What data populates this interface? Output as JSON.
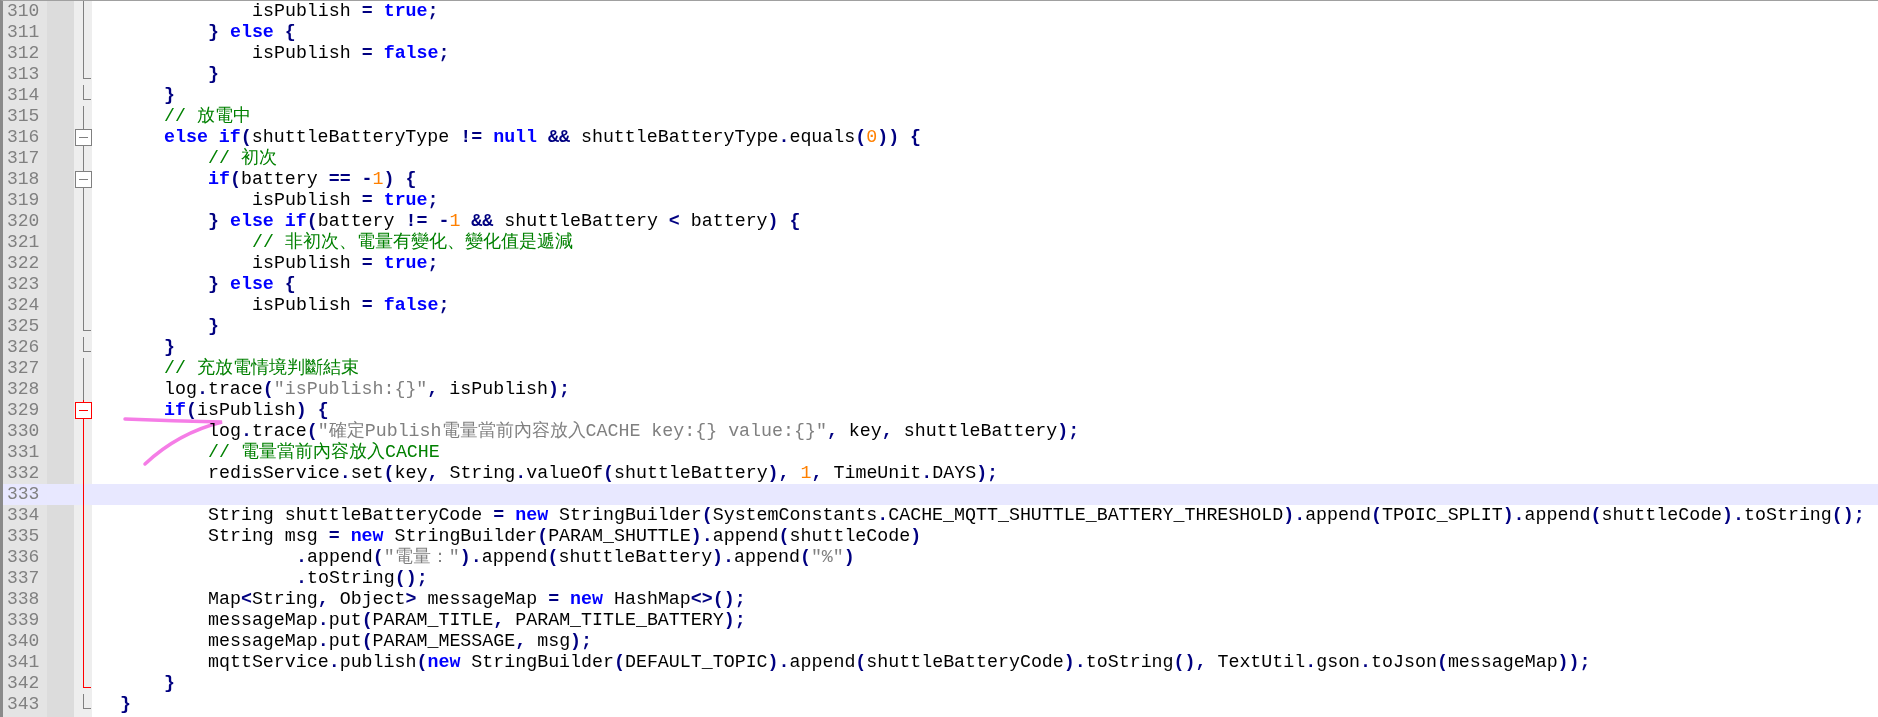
{
  "editor": {
    "lines": [
      {
        "number": "310",
        "kind": "line",
        "fold_highlight": false,
        "current": false,
        "tokens": [
          {
            "kind": "txt",
            "text": "              isPublish "
          },
          {
            "kind": "op",
            "text": "= "
          },
          {
            "kind": "kw",
            "text": "true"
          },
          {
            "kind": "op",
            "text": ";"
          }
        ]
      },
      {
        "number": "311",
        "kind": "line",
        "fold_highlight": false,
        "current": false,
        "tokens": [
          {
            "kind": "op",
            "text": "          } "
          },
          {
            "kind": "kw",
            "text": "else "
          },
          {
            "kind": "op",
            "text": "{"
          }
        ]
      },
      {
        "number": "312",
        "kind": "line",
        "fold_highlight": false,
        "current": false,
        "tokens": [
          {
            "kind": "txt",
            "text": "              isPublish "
          },
          {
            "kind": "op",
            "text": "= "
          },
          {
            "kind": "kw",
            "text": "false"
          },
          {
            "kind": "op",
            "text": ";"
          }
        ]
      },
      {
        "number": "313",
        "kind": "end",
        "fold_highlight": false,
        "current": false,
        "tokens": [
          {
            "kind": "op",
            "text": "          }"
          }
        ]
      },
      {
        "number": "314",
        "kind": "end",
        "fold_highlight": false,
        "current": false,
        "tokens": [
          {
            "kind": "op",
            "text": "      }"
          }
        ]
      },
      {
        "number": "315",
        "kind": "line",
        "fold_highlight": false,
        "current": false,
        "tokens": [
          {
            "kind": "cmt",
            "text": "      // 放電中"
          }
        ]
      },
      {
        "number": "316",
        "kind": "open",
        "fold_highlight": false,
        "current": false,
        "tokens": [
          {
            "kind": "kw",
            "text": "      else if"
          },
          {
            "kind": "op",
            "text": "("
          },
          {
            "kind": "txt",
            "text": "shuttleBatteryType "
          },
          {
            "kind": "op",
            "text": "!= "
          },
          {
            "kind": "kw",
            "text": "null "
          },
          {
            "kind": "op",
            "text": "&&"
          },
          {
            "kind": "txt",
            "text": " shuttleBatteryType"
          },
          {
            "kind": "op",
            "text": "."
          },
          {
            "kind": "txt",
            "text": "equals"
          },
          {
            "kind": "op",
            "text": "("
          },
          {
            "kind": "num",
            "text": "0"
          },
          {
            "kind": "op",
            "text": ")) {"
          }
        ]
      },
      {
        "number": "317",
        "kind": "line",
        "fold_highlight": false,
        "current": false,
        "tokens": [
          {
            "kind": "cmt",
            "text": "          // 初次"
          }
        ]
      },
      {
        "number": "318",
        "kind": "open",
        "fold_highlight": false,
        "current": false,
        "tokens": [
          {
            "kind": "kw",
            "text": "          if"
          },
          {
            "kind": "op",
            "text": "("
          },
          {
            "kind": "txt",
            "text": "battery "
          },
          {
            "kind": "op",
            "text": "== -"
          },
          {
            "kind": "num",
            "text": "1"
          },
          {
            "kind": "op",
            "text": ") {"
          }
        ]
      },
      {
        "number": "319",
        "kind": "line",
        "fold_highlight": false,
        "current": false,
        "tokens": [
          {
            "kind": "txt",
            "text": "              isPublish "
          },
          {
            "kind": "op",
            "text": "= "
          },
          {
            "kind": "kw",
            "text": "true"
          },
          {
            "kind": "op",
            "text": ";"
          }
        ]
      },
      {
        "number": "320",
        "kind": "line",
        "fold_highlight": false,
        "current": false,
        "tokens": [
          {
            "kind": "op",
            "text": "          } "
          },
          {
            "kind": "kw",
            "text": "else if"
          },
          {
            "kind": "op",
            "text": "("
          },
          {
            "kind": "txt",
            "text": "battery "
          },
          {
            "kind": "op",
            "text": "!= -"
          },
          {
            "kind": "num",
            "text": "1"
          },
          {
            "kind": "op",
            "text": " &&"
          },
          {
            "kind": "txt",
            "text": " shuttleBattery "
          },
          {
            "kind": "op",
            "text": "<"
          },
          {
            "kind": "txt",
            "text": " battery"
          },
          {
            "kind": "op",
            "text": ") {"
          }
        ]
      },
      {
        "number": "321",
        "kind": "line",
        "fold_highlight": false,
        "current": false,
        "tokens": [
          {
            "kind": "cmt",
            "text": "              // 非初次、電量有變化、變化值是遞減"
          }
        ]
      },
      {
        "number": "322",
        "kind": "line",
        "fold_highlight": false,
        "current": false,
        "tokens": [
          {
            "kind": "txt",
            "text": "              isPublish "
          },
          {
            "kind": "op",
            "text": "= "
          },
          {
            "kind": "kw",
            "text": "true"
          },
          {
            "kind": "op",
            "text": ";"
          }
        ]
      },
      {
        "number": "323",
        "kind": "line",
        "fold_highlight": false,
        "current": false,
        "tokens": [
          {
            "kind": "op",
            "text": "          } "
          },
          {
            "kind": "kw",
            "text": "else "
          },
          {
            "kind": "op",
            "text": "{"
          }
        ]
      },
      {
        "number": "324",
        "kind": "line",
        "fold_highlight": false,
        "current": false,
        "tokens": [
          {
            "kind": "txt",
            "text": "              isPublish "
          },
          {
            "kind": "op",
            "text": "= "
          },
          {
            "kind": "kw",
            "text": "false"
          },
          {
            "kind": "op",
            "text": ";"
          }
        ]
      },
      {
        "number": "325",
        "kind": "end",
        "fold_highlight": false,
        "current": false,
        "tokens": [
          {
            "kind": "op",
            "text": "          }"
          }
        ]
      },
      {
        "number": "326",
        "kind": "end",
        "fold_highlight": false,
        "current": false,
        "tokens": [
          {
            "kind": "op",
            "text": "      }"
          }
        ]
      },
      {
        "number": "327",
        "kind": "line",
        "fold_highlight": false,
        "current": false,
        "tokens": [
          {
            "kind": "cmt",
            "text": "      // 充放電情境判斷結束"
          }
        ]
      },
      {
        "number": "328",
        "kind": "line",
        "fold_highlight": false,
        "current": false,
        "tokens": [
          {
            "kind": "txt",
            "text": "      log"
          },
          {
            "kind": "op",
            "text": "."
          },
          {
            "kind": "txt",
            "text": "trace"
          },
          {
            "kind": "op",
            "text": "("
          },
          {
            "kind": "str",
            "text": "\"isPublish:{}\""
          },
          {
            "kind": "op",
            "text": ","
          },
          {
            "kind": "txt",
            "text": " isPublish"
          },
          {
            "kind": "op",
            "text": ");"
          }
        ]
      },
      {
        "number": "329",
        "kind": "open",
        "fold_highlight": true,
        "current": false,
        "tokens": [
          {
            "kind": "kw",
            "text": "      if"
          },
          {
            "kind": "op",
            "text": "("
          },
          {
            "kind": "txt",
            "text": "isPublish"
          },
          {
            "kind": "op",
            "text": ") {"
          }
        ]
      },
      {
        "number": "330",
        "kind": "line",
        "fold_highlight": true,
        "current": false,
        "tokens": [
          {
            "kind": "txt",
            "text": "          log"
          },
          {
            "kind": "op",
            "text": "."
          },
          {
            "kind": "txt",
            "text": "trace"
          },
          {
            "kind": "op",
            "text": "("
          },
          {
            "kind": "str",
            "text": "\"確定Publish電量當前內容放入CACHE key:{} value:{}\""
          },
          {
            "kind": "op",
            "text": ","
          },
          {
            "kind": "txt",
            "text": " key"
          },
          {
            "kind": "op",
            "text": ","
          },
          {
            "kind": "txt",
            "text": " shuttleBattery"
          },
          {
            "kind": "op",
            "text": ");"
          }
        ]
      },
      {
        "number": "331",
        "kind": "line",
        "fold_highlight": true,
        "current": false,
        "tokens": [
          {
            "kind": "cmt",
            "text": "          // 電量當前內容放入CACHE"
          }
        ]
      },
      {
        "number": "332",
        "kind": "line",
        "fold_highlight": true,
        "current": false,
        "tokens": [
          {
            "kind": "txt",
            "text": "          redisService"
          },
          {
            "kind": "op",
            "text": "."
          },
          {
            "kind": "txt",
            "text": "set"
          },
          {
            "kind": "op",
            "text": "("
          },
          {
            "kind": "txt",
            "text": "key"
          },
          {
            "kind": "op",
            "text": ","
          },
          {
            "kind": "txt",
            "text": " String"
          },
          {
            "kind": "op",
            "text": "."
          },
          {
            "kind": "txt",
            "text": "valueOf"
          },
          {
            "kind": "op",
            "text": "("
          },
          {
            "kind": "txt",
            "text": "shuttleBattery"
          },
          {
            "kind": "op",
            "text": "), "
          },
          {
            "kind": "num",
            "text": "1"
          },
          {
            "kind": "op",
            "text": ","
          },
          {
            "kind": "txt",
            "text": " TimeUnit"
          },
          {
            "kind": "op",
            "text": "."
          },
          {
            "kind": "txt",
            "text": "DAYS"
          },
          {
            "kind": "op",
            "text": ");"
          }
        ]
      },
      {
        "number": "333",
        "kind": "line",
        "fold_highlight": true,
        "current": true
      },
      {
        "number": "334",
        "kind": "line",
        "fold_highlight": true,
        "current": false,
        "tokens": [
          {
            "kind": "txt",
            "text": "          String shuttleBatteryCode "
          },
          {
            "kind": "op",
            "text": "= "
          },
          {
            "kind": "kw",
            "text": "new"
          },
          {
            "kind": "txt",
            "text": " StringBuilder"
          },
          {
            "kind": "op",
            "text": "("
          },
          {
            "kind": "txt",
            "text": "SystemConstants"
          },
          {
            "kind": "op",
            "text": "."
          },
          {
            "kind": "txt",
            "text": "CACHE_MQTT_SHUTTLE_BATTERY_THRESHOLD"
          },
          {
            "kind": "op",
            "text": ")."
          },
          {
            "kind": "txt",
            "text": "append"
          },
          {
            "kind": "op",
            "text": "("
          },
          {
            "kind": "txt",
            "text": "TPOIC_SPLIT"
          },
          {
            "kind": "op",
            "text": ")."
          },
          {
            "kind": "txt",
            "text": "append"
          },
          {
            "kind": "op",
            "text": "("
          },
          {
            "kind": "txt",
            "text": "shuttleCode"
          },
          {
            "kind": "op",
            "text": ")."
          },
          {
            "kind": "txt",
            "text": "toString"
          },
          {
            "kind": "op",
            "text": "();"
          }
        ]
      },
      {
        "number": "335",
        "kind": "line",
        "fold_highlight": true,
        "current": false,
        "tokens": [
          {
            "kind": "txt",
            "text": "          String msg "
          },
          {
            "kind": "op",
            "text": "= "
          },
          {
            "kind": "kw",
            "text": "new"
          },
          {
            "kind": "txt",
            "text": " StringBuilder"
          },
          {
            "kind": "op",
            "text": "("
          },
          {
            "kind": "txt",
            "text": "PARAM_SHUTTLE"
          },
          {
            "kind": "op",
            "text": ")."
          },
          {
            "kind": "txt",
            "text": "append"
          },
          {
            "kind": "op",
            "text": "("
          },
          {
            "kind": "txt",
            "text": "shuttleCode"
          },
          {
            "kind": "op",
            "text": ")"
          }
        ]
      },
      {
        "number": "336",
        "kind": "line",
        "fold_highlight": true,
        "current": false,
        "tokens": [
          {
            "kind": "op",
            "text": "                  ."
          },
          {
            "kind": "txt",
            "text": "append"
          },
          {
            "kind": "op",
            "text": "("
          },
          {
            "kind": "str",
            "text": "\"電量：\""
          },
          {
            "kind": "op",
            "text": ")."
          },
          {
            "kind": "txt",
            "text": "append"
          },
          {
            "kind": "op",
            "text": "("
          },
          {
            "kind": "txt",
            "text": "shuttleBattery"
          },
          {
            "kind": "op",
            "text": ")."
          },
          {
            "kind": "txt",
            "text": "append"
          },
          {
            "kind": "op",
            "text": "("
          },
          {
            "kind": "str",
            "text": "\"%\""
          },
          {
            "kind": "op",
            "text": ")"
          }
        ]
      },
      {
        "number": "337",
        "kind": "line",
        "fold_highlight": true,
        "current": false,
        "tokens": [
          {
            "kind": "op",
            "text": "                  ."
          },
          {
            "kind": "txt",
            "text": "toString"
          },
          {
            "kind": "op",
            "text": "();"
          }
        ]
      },
      {
        "number": "338",
        "kind": "line",
        "fold_highlight": true,
        "current": false,
        "tokens": [
          {
            "kind": "txt",
            "text": "          Map"
          },
          {
            "kind": "op",
            "text": "<"
          },
          {
            "kind": "txt",
            "text": "String"
          },
          {
            "kind": "op",
            "text": ","
          },
          {
            "kind": "txt",
            "text": " Object"
          },
          {
            "kind": "op",
            "text": ">"
          },
          {
            "kind": "txt",
            "text": " messageMap "
          },
          {
            "kind": "op",
            "text": "= "
          },
          {
            "kind": "kw",
            "text": "new"
          },
          {
            "kind": "txt",
            "text": " HashMap"
          },
          {
            "kind": "op",
            "text": "<>();"
          }
        ]
      },
      {
        "number": "339",
        "kind": "line",
        "fold_highlight": true,
        "current": false,
        "tokens": [
          {
            "kind": "txt",
            "text": "          messageMap"
          },
          {
            "kind": "op",
            "text": "."
          },
          {
            "kind": "txt",
            "text": "put"
          },
          {
            "kind": "op",
            "text": "("
          },
          {
            "kind": "txt",
            "text": "PARAM_TITLE"
          },
          {
            "kind": "op",
            "text": ","
          },
          {
            "kind": "txt",
            "text": " PARAM_TITLE_BATTERY"
          },
          {
            "kind": "op",
            "text": ");"
          }
        ]
      },
      {
        "number": "340",
        "kind": "line",
        "fold_highlight": true,
        "current": false,
        "tokens": [
          {
            "kind": "txt",
            "text": "          messageMap"
          },
          {
            "kind": "op",
            "text": "."
          },
          {
            "kind": "txt",
            "text": "put"
          },
          {
            "kind": "op",
            "text": "("
          },
          {
            "kind": "txt",
            "text": "PARAM_MESSAGE"
          },
          {
            "kind": "op",
            "text": ","
          },
          {
            "kind": "txt",
            "text": " msg"
          },
          {
            "kind": "op",
            "text": ");"
          }
        ]
      },
      {
        "number": "341",
        "kind": "line",
        "fold_highlight": true,
        "current": false,
        "tokens": [
          {
            "kind": "txt",
            "text": "          mqttService"
          },
          {
            "kind": "op",
            "text": "."
          },
          {
            "kind": "txt",
            "text": "publish"
          },
          {
            "kind": "op",
            "text": "("
          },
          {
            "kind": "kw",
            "text": "new"
          },
          {
            "kind": "txt",
            "text": " StringBuilder"
          },
          {
            "kind": "op",
            "text": "("
          },
          {
            "kind": "txt",
            "text": "DEFAULT_TOPIC"
          },
          {
            "kind": "op",
            "text": ")."
          },
          {
            "kind": "txt",
            "text": "append"
          },
          {
            "kind": "op",
            "text": "("
          },
          {
            "kind": "txt",
            "text": "shuttleBatteryCode"
          },
          {
            "kind": "op",
            "text": ")."
          },
          {
            "kind": "txt",
            "text": "toString"
          },
          {
            "kind": "op",
            "text": "(),"
          },
          {
            "kind": "txt",
            "text": " TextUtil"
          },
          {
            "kind": "op",
            "text": "."
          },
          {
            "kind": "txt",
            "text": "gson"
          },
          {
            "kind": "op",
            "text": "."
          },
          {
            "kind": "txt",
            "text": "toJson"
          },
          {
            "kind": "op",
            "text": "("
          },
          {
            "kind": "txt",
            "text": "messageMap"
          },
          {
            "kind": "op",
            "text": "));"
          }
        ]
      },
      {
        "number": "342",
        "kind": "end",
        "fold_highlight": true,
        "current": false,
        "tokens": [
          {
            "kind": "op",
            "text": "      }"
          }
        ]
      },
      {
        "number": "343",
        "kind": "end",
        "fold_highlight": false,
        "current": false,
        "tokens": [
          {
            "kind": "op",
            "text": "  }"
          }
        ]
      }
    ]
  }
}
